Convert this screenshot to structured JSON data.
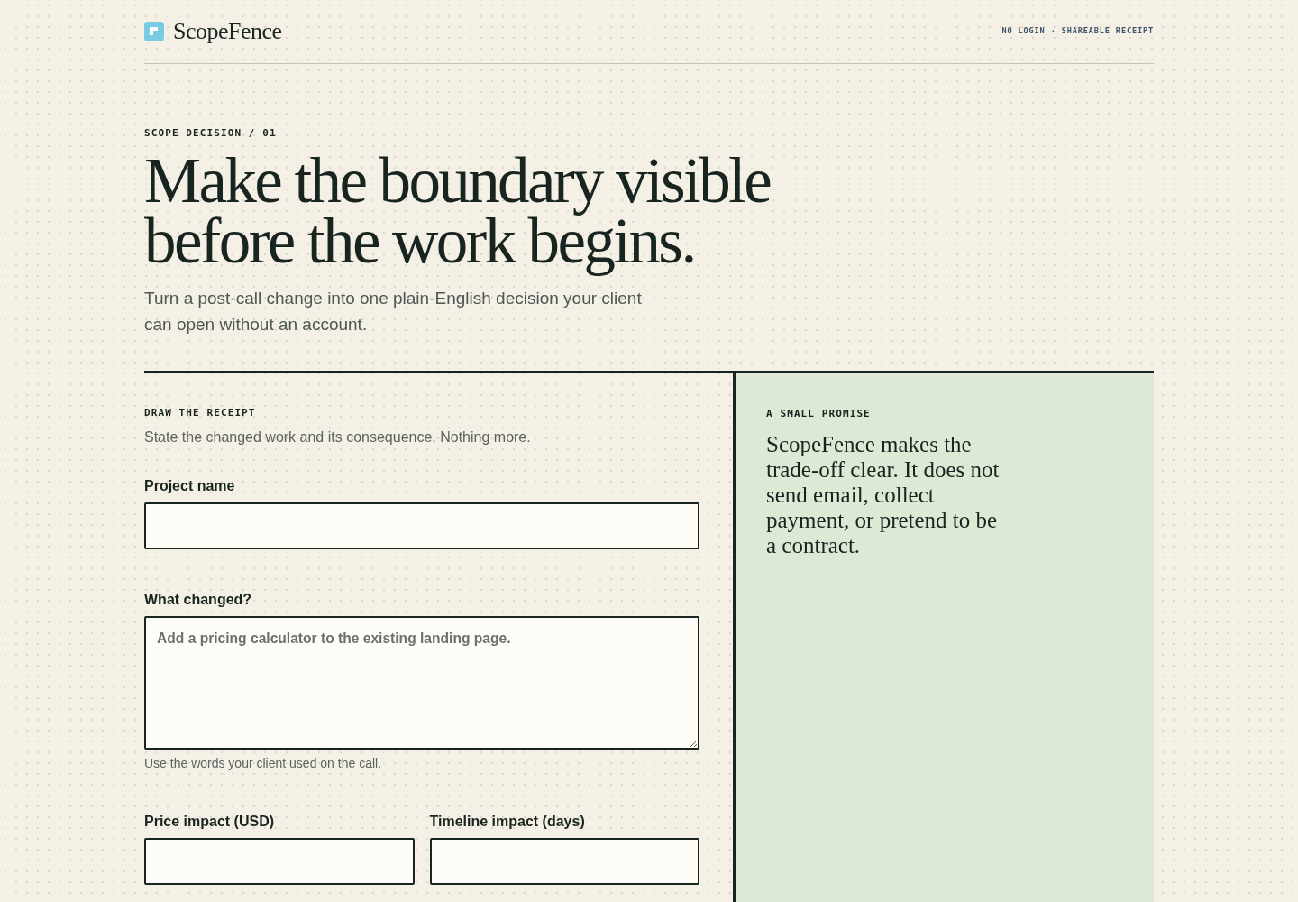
{
  "header": {
    "brand": "ScopeFence",
    "tagline": "NO LOGIN · SHAREABLE RECEIPT"
  },
  "hero": {
    "eyebrow": "SCOPE DECISION / 01",
    "title": "Make the boundary visible before the work begins.",
    "lead": "Turn a post-call change into one plain-English decision your client can open without an account."
  },
  "form": {
    "eyebrow": "DRAW THE RECEIPT",
    "intro": "State the changed work and its consequence. Nothing more.",
    "rows": [
      {
        "fields": [
          {
            "kind": "input",
            "label": "Project name"
          }
        ]
      },
      {
        "fields": [
          {
            "kind": "textarea",
            "label": "What changed?",
            "placeholder": "Add a pricing calculator to the existing landing page.",
            "help": "Use the words your client used on the call."
          }
        ]
      },
      {
        "fields": [
          {
            "kind": "input",
            "label": "Price impact (USD)"
          },
          {
            "kind": "input",
            "label": "Timeline impact (days)"
          }
        ]
      }
    ]
  },
  "aside": {
    "eyebrow": "A SMALL PROMISE",
    "text": "ScopeFence makes the trade-off clear. It does not send email, collect payment, or pretend to be a contract."
  }
}
